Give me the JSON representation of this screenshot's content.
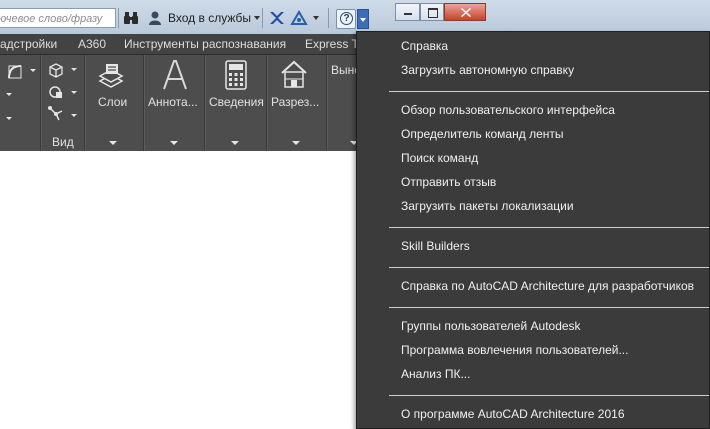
{
  "titlebar": {
    "search_placeholder": "ючевое слово/фразу",
    "signin_label": "Вход в службы"
  },
  "ribbon": {
    "tabs": [
      "адстройки",
      "A360",
      "Инструменты распознавания",
      "Express To"
    ],
    "panels": {
      "view_label": "Вид",
      "layers_label": "Слои",
      "annotation_label": "Аннота...",
      "properties_label": "Сведения",
      "section_label": "Разрез...",
      "extra_label": "Выно"
    }
  },
  "help_menu": {
    "groups": [
      [
        "Справка",
        "Загрузить автономную справку"
      ],
      [
        "Обзор пользовательского интерфейса",
        "Определитель команд ленты",
        "Поиск команд",
        "Отправить отзыв",
        "Загрузить пакеты локализации"
      ],
      [
        "Skill Builders"
      ],
      [
        "Справка по AutoCAD Architecture для разработчиков"
      ],
      [
        "Группы пользователей Autodesk",
        "Программа вовлечения пользователей...",
        "Анализ ПК..."
      ],
      [
        "О программе AutoCAD Architecture 2016"
      ]
    ]
  },
  "colors": {
    "menu_bg": "#3b3b3b",
    "ribbon_bg": "#4d4d4d",
    "tab_bg": "#434343",
    "titlebar_bg": "#c4d2e2",
    "help_accent": "#3d6eb4"
  }
}
